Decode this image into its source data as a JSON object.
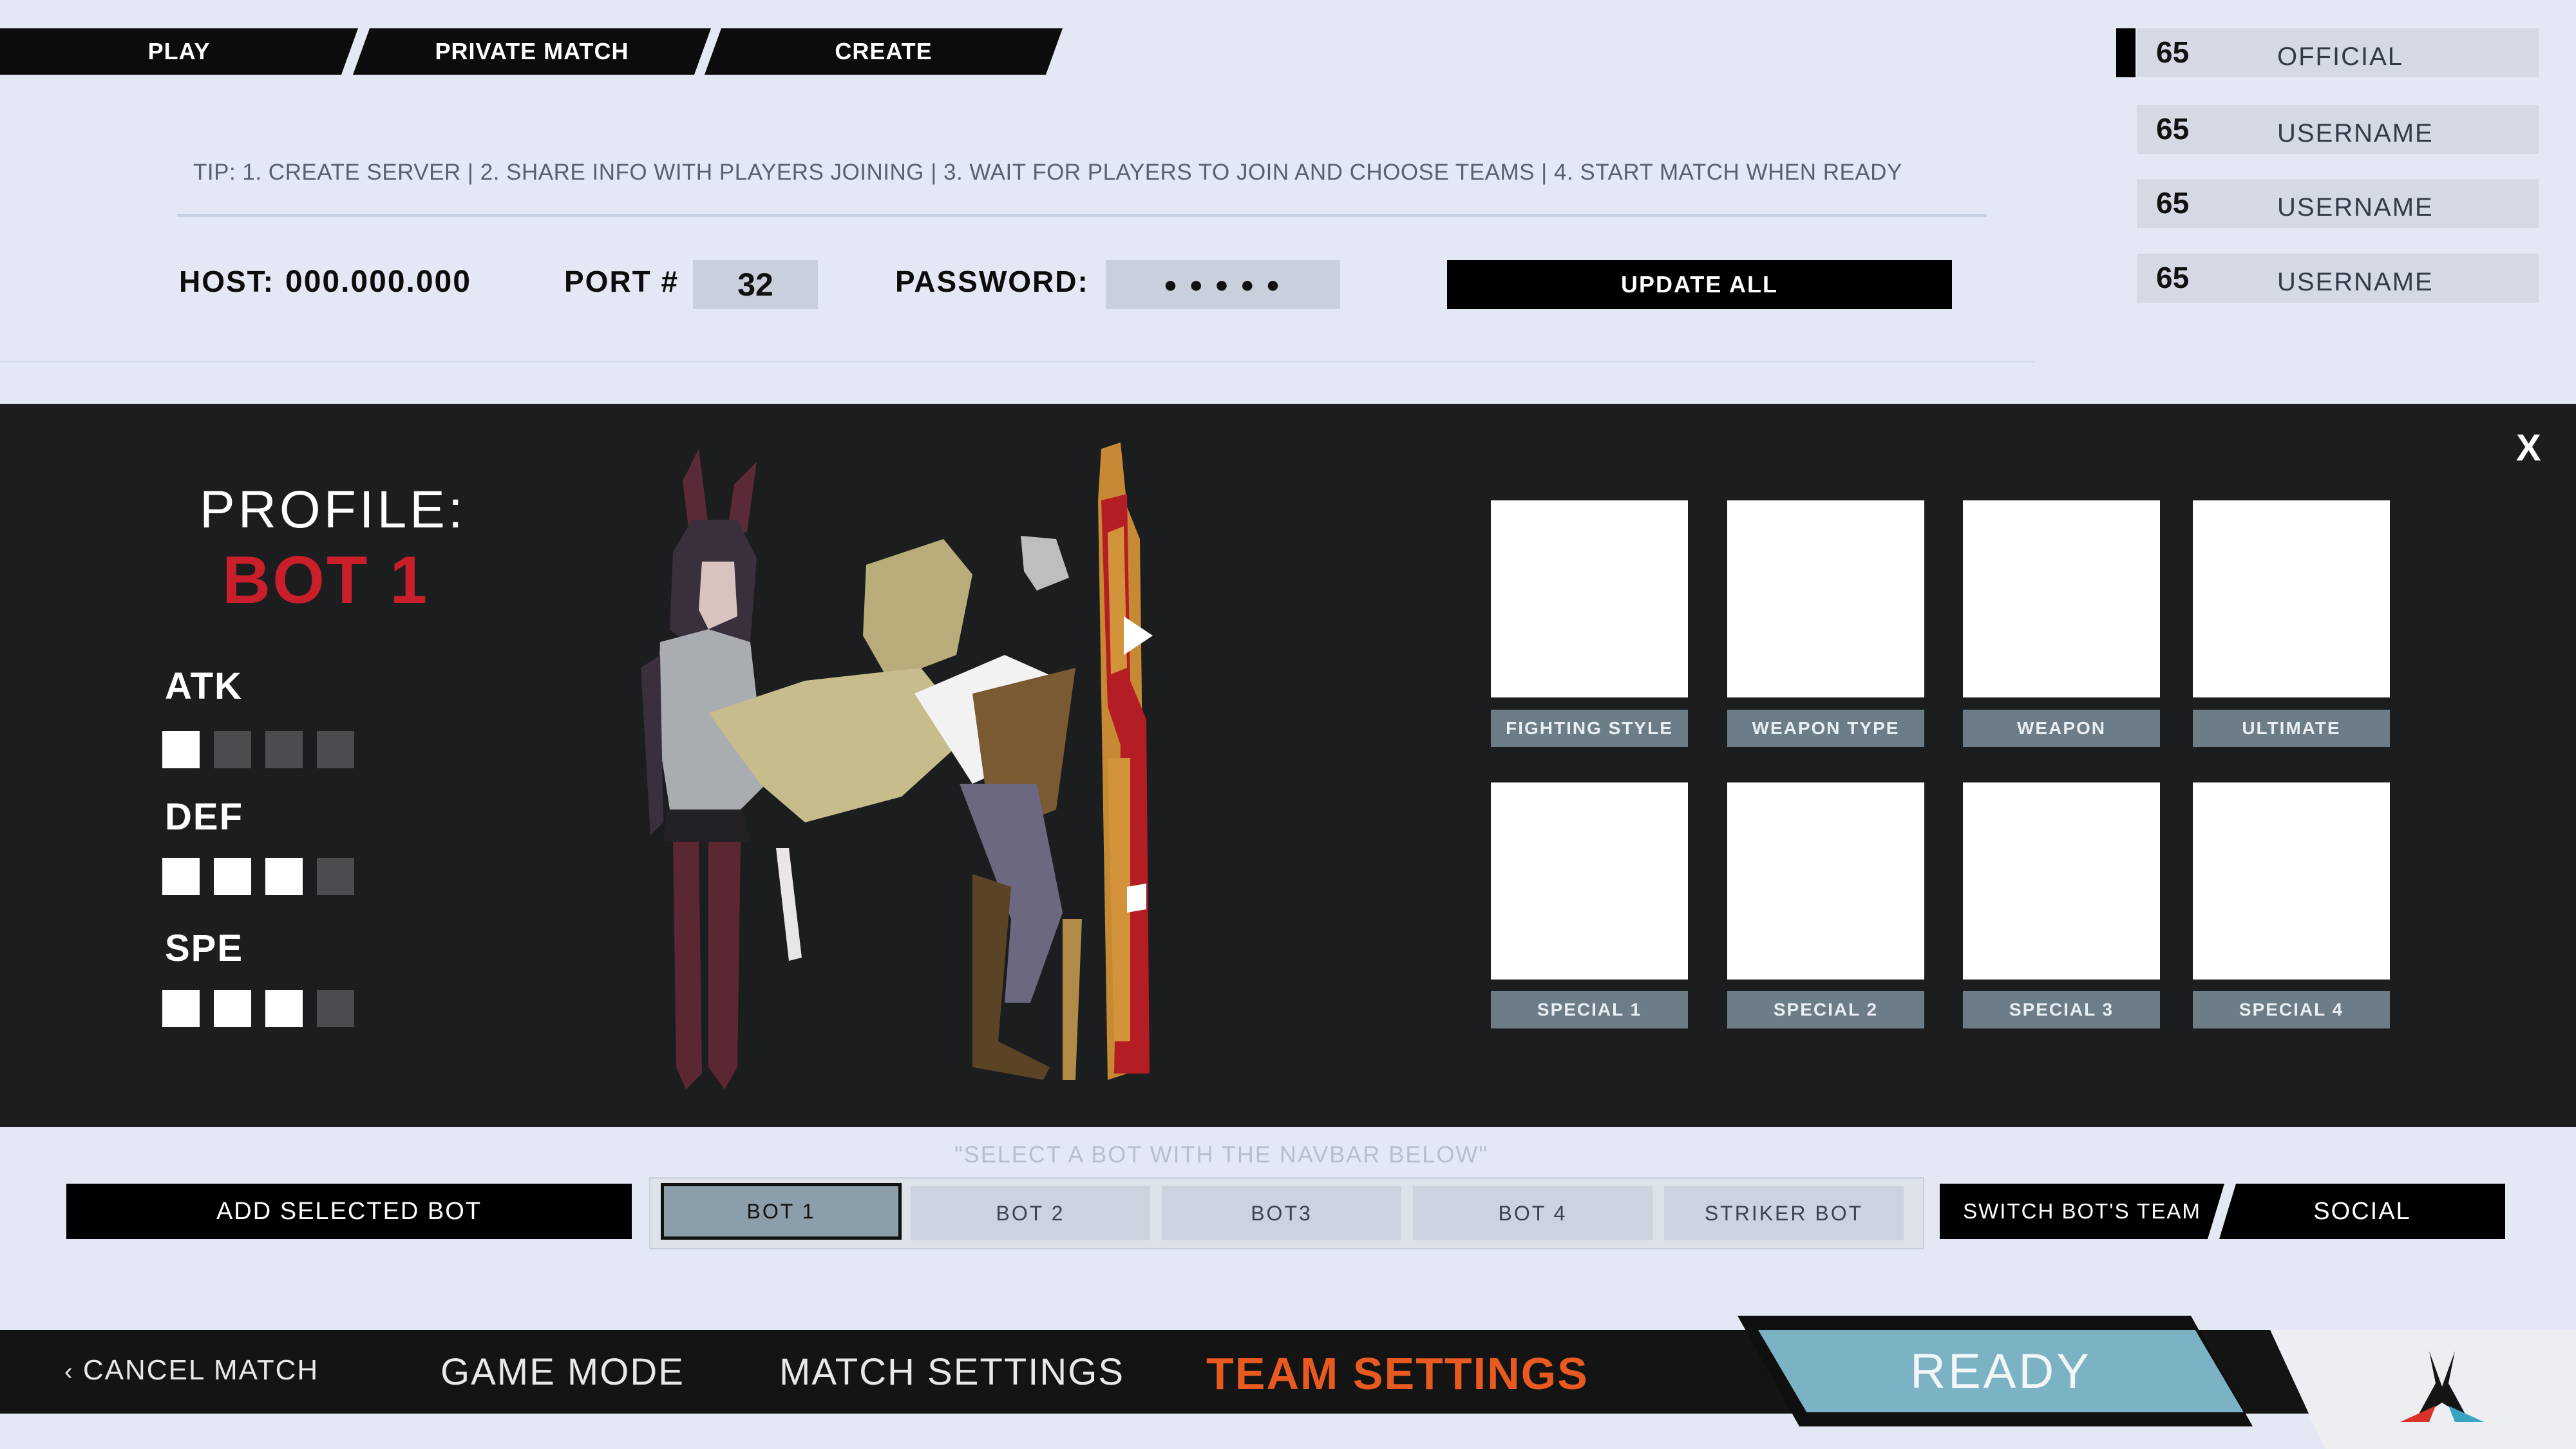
{
  "top_tabs": [
    "PLAY",
    "PRIVATE MATCH",
    "CREATE"
  ],
  "tip": "TIP: 1. CREATE SERVER  |  2. SHARE INFO WITH PLAYERS JOINING  |  3. WAIT FOR PLAYERS TO JOIN AND CHOOSE TEAMS |  4. START MATCH WHEN READY",
  "server": {
    "host_label": "HOST:",
    "host_value": "000.000.000",
    "port_label": "PORT #",
    "port_value": "32",
    "password_label": "PASSWORD:",
    "password_value": "● ● ● ● ●",
    "update_label": "UPDATE ALL"
  },
  "roster": [
    {
      "level": "65",
      "name": "OFFICIAL"
    },
    {
      "level": "65",
      "name": "USERNAME"
    },
    {
      "level": "65",
      "name": "USERNAME"
    },
    {
      "level": "65",
      "name": "USERNAME"
    }
  ],
  "profile": {
    "title": "PROFILE:",
    "name": "BOT 1",
    "close": "X",
    "stats": [
      {
        "label": "ATK",
        "value": 1,
        "max": 4
      },
      {
        "label": "DEF",
        "value": 3,
        "max": 4
      },
      {
        "label": "SPE",
        "value": 3,
        "max": 4
      }
    ],
    "slots": [
      "FIGHTING STYLE",
      "WEAPON TYPE",
      "WEAPON",
      "ULTIMATE",
      "SPECIAL 1",
      "SPECIAL 2",
      "SPECIAL 3",
      "SPECIAL 4"
    ]
  },
  "hint": "\"SELECT A BOT WITH THE NAVBAR BELOW\"",
  "bot_controls": {
    "add_label": "ADD SELECTED BOT",
    "bots": [
      "BOT 1",
      "BOT 2",
      "BOT3",
      "BOT 4",
      "STRIKER BOT"
    ],
    "selected": "BOT 1",
    "switch_label": "SWITCH BOT'S TEAM",
    "social_label": "SOCIAL"
  },
  "bottom_nav": {
    "cancel": "CANCEL MATCH",
    "cancel_icon": "chevron-left-icon",
    "game_mode": "GAME MODE",
    "match_settings": "MATCH SETTINGS",
    "team_settings": "TEAM SETTINGS",
    "ready": "READY",
    "logo": "game-logo-icon"
  },
  "colors": {
    "accent_red": "#c81f2a",
    "active_orange": "#e85a1f",
    "ready_blue": "#7bb3c4",
    "panel": "#1c1d1f",
    "pip_on": "#ffffff",
    "pip_off": "#4a4c4f"
  }
}
